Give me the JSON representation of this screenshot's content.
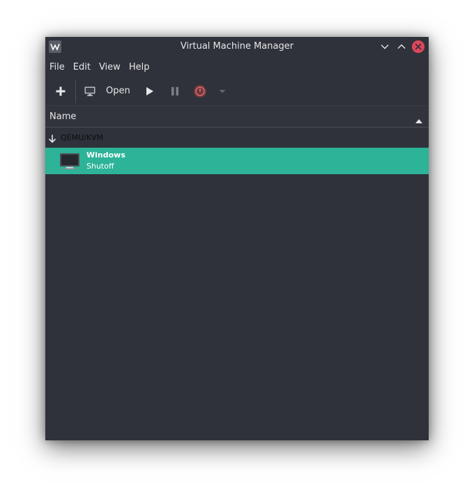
{
  "window": {
    "title": "Virtual Machine Manager",
    "app_icon": "virt-manager-icon"
  },
  "titlebar_controls": [
    "minimize-icon",
    "maximize-icon",
    "close-icon"
  ],
  "menubar": {
    "items": [
      {
        "label": "File"
      },
      {
        "label": "Edit"
      },
      {
        "label": "View"
      },
      {
        "label": "Help"
      }
    ]
  },
  "toolbar": {
    "new_vm_icon": "plus-icon",
    "open_icon": "monitor-icon",
    "open_label": "Open",
    "run_icon": "play-icon",
    "pause_icon": "pause-icon",
    "shutdown_icon": "power-icon",
    "shutdown_menu_icon": "chevron-down-icon"
  },
  "list_header": {
    "name_label": "Name",
    "sort_direction": "ascending"
  },
  "groups": [
    {
      "label": "QEMU/KVM",
      "expanded": true,
      "vms": [
        {
          "name": "Windows",
          "state": "Shutoff",
          "selected": true
        }
      ]
    }
  ],
  "colors": {
    "window_bg": "#2f323a",
    "selection": "#2db398",
    "close_button": "#e0475a",
    "text": "#e6e7e9",
    "group_text": "#0c0d0f"
  }
}
